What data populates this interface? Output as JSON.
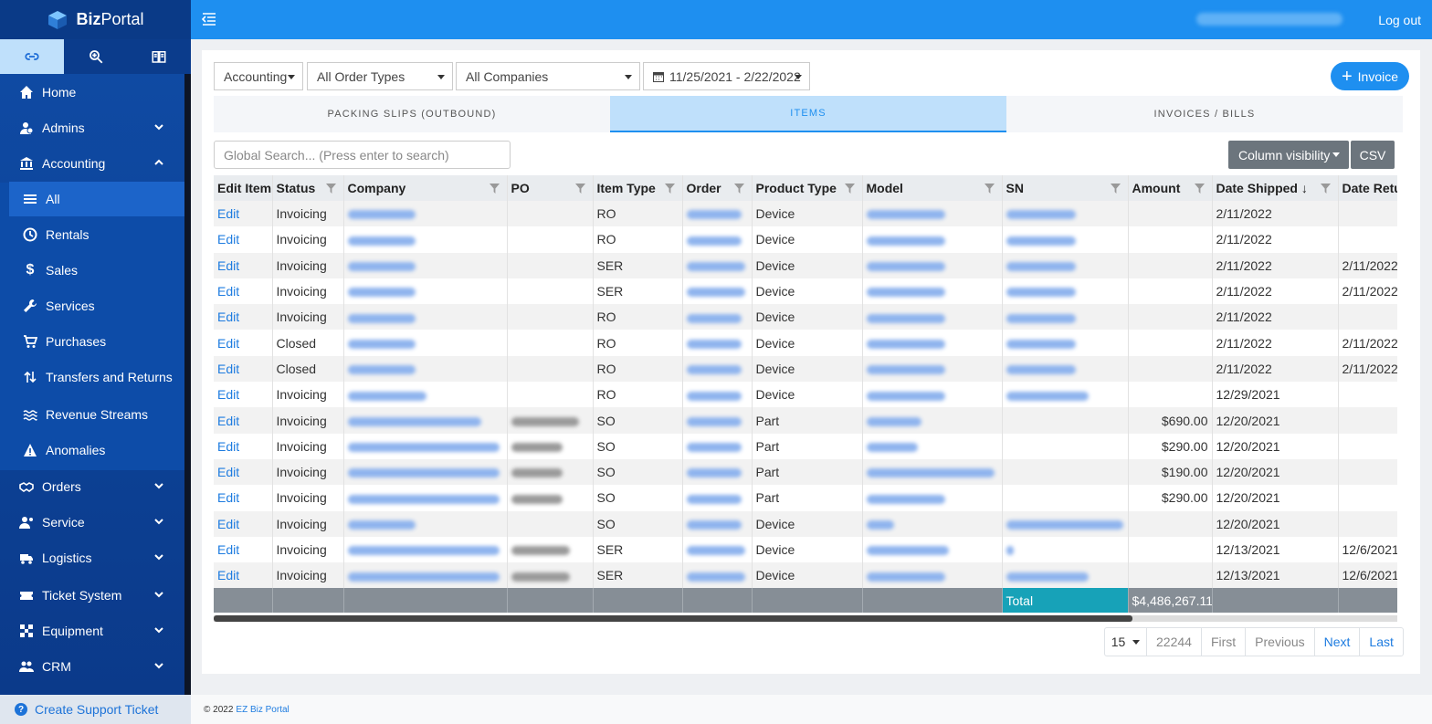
{
  "brand": {
    "name_bold": "Biz",
    "name_rest": "Portal"
  },
  "topbar": {
    "logout": "Log out"
  },
  "nav": {
    "items": [
      {
        "label": "Home",
        "icon": "home-icon"
      },
      {
        "label": "Admins",
        "icon": "admins-icon"
      },
      {
        "label": "Accounting",
        "icon": "bank-icon"
      },
      {
        "label": "All",
        "icon": "list-icon"
      },
      {
        "label": "Rentals",
        "icon": "clock-icon"
      },
      {
        "label": "Sales",
        "icon": "dollar-icon"
      },
      {
        "label": "Services",
        "icon": "wrench-icon"
      },
      {
        "label": "Purchases",
        "icon": "cart-icon"
      },
      {
        "label": "Transfers and Returns",
        "icon": "transfer-icon"
      },
      {
        "label": "Revenue Streams",
        "icon": "stream-icon"
      },
      {
        "label": "Anomalies",
        "icon": "warning-icon"
      },
      {
        "label": "Orders",
        "icon": "handshake-icon"
      },
      {
        "label": "Service",
        "icon": "service-icon"
      },
      {
        "label": "Logistics",
        "icon": "truck-icon"
      },
      {
        "label": "Ticket System",
        "icon": "ticket-icon"
      },
      {
        "label": "Equipment",
        "icon": "equipment-icon"
      },
      {
        "label": "CRM",
        "icon": "crm-icon"
      }
    ],
    "support": "Create Support Ticket"
  },
  "filters": {
    "category": "Accounting",
    "order_types": "All Order Types",
    "companies": "All Companies",
    "date_range": "11/25/2021 - 2/22/2022"
  },
  "invoice_button": "Invoice",
  "tabs": [
    "PACKING SLIPS (OUTBOUND)",
    "ITEMS",
    "INVOICES / BILLS"
  ],
  "search": {
    "placeholder": "Global Search... (Press enter to search)"
  },
  "column_visibility": "Column visibility",
  "csv": "CSV",
  "table": {
    "headers": [
      "Edit Item",
      "Status",
      "Company",
      "PO",
      "Item Type",
      "Order",
      "Product Type",
      "Model",
      "SN",
      "Amount",
      "Date Shipped",
      "Date Retu"
    ],
    "rows": [
      {
        "edit": "Edit",
        "status": "Invoicing",
        "item_type": "RO",
        "product_type": "Device",
        "amount": "",
        "date_shipped": "2/11/2022",
        "date_returned": ""
      },
      {
        "edit": "Edit",
        "status": "Invoicing",
        "item_type": "RO",
        "product_type": "Device",
        "amount": "",
        "date_shipped": "2/11/2022",
        "date_returned": ""
      },
      {
        "edit": "Edit",
        "status": "Invoicing",
        "item_type": "SER",
        "product_type": "Device",
        "amount": "",
        "date_shipped": "2/11/2022",
        "date_returned": "2/11/2022"
      },
      {
        "edit": "Edit",
        "status": "Invoicing",
        "item_type": "SER",
        "product_type": "Device",
        "amount": "",
        "date_shipped": "2/11/2022",
        "date_returned": "2/11/2022"
      },
      {
        "edit": "Edit",
        "status": "Invoicing",
        "item_type": "RO",
        "product_type": "Device",
        "amount": "",
        "date_shipped": "2/11/2022",
        "date_returned": ""
      },
      {
        "edit": "Edit",
        "status": "Closed",
        "item_type": "RO",
        "product_type": "Device",
        "amount": "",
        "date_shipped": "2/11/2022",
        "date_returned": "2/11/2022"
      },
      {
        "edit": "Edit",
        "status": "Closed",
        "item_type": "RO",
        "product_type": "Device",
        "amount": "",
        "date_shipped": "2/11/2022",
        "date_returned": "2/11/2022"
      },
      {
        "edit": "Edit",
        "status": "Invoicing",
        "item_type": "RO",
        "product_type": "Device",
        "amount": "",
        "date_shipped": "12/29/2021",
        "date_returned": ""
      },
      {
        "edit": "Edit",
        "status": "Invoicing",
        "item_type": "SO",
        "product_type": "Part",
        "amount": "$690.00",
        "date_shipped": "12/20/2021",
        "date_returned": ""
      },
      {
        "edit": "Edit",
        "status": "Invoicing",
        "item_type": "SO",
        "product_type": "Part",
        "amount": "$290.00",
        "date_shipped": "12/20/2021",
        "date_returned": ""
      },
      {
        "edit": "Edit",
        "status": "Invoicing",
        "item_type": "SO",
        "product_type": "Part",
        "amount": "$190.00",
        "date_shipped": "12/20/2021",
        "date_returned": ""
      },
      {
        "edit": "Edit",
        "status": "Invoicing",
        "item_type": "SO",
        "product_type": "Part",
        "amount": "$290.00",
        "date_shipped": "12/20/2021",
        "date_returned": ""
      },
      {
        "edit": "Edit",
        "status": "Invoicing",
        "item_type": "SO",
        "product_type": "Device",
        "amount": "",
        "date_shipped": "12/20/2021",
        "date_returned": ""
      },
      {
        "edit": "Edit",
        "status": "Invoicing",
        "item_type": "SER",
        "product_type": "Device",
        "amount": "",
        "date_shipped": "12/13/2021",
        "date_returned": "12/6/2021"
      },
      {
        "edit": "Edit",
        "status": "Invoicing",
        "item_type": "SER",
        "product_type": "Device",
        "amount": "",
        "date_shipped": "12/13/2021",
        "date_returned": "12/6/2021"
      }
    ],
    "total_label": "Total",
    "total_amount": "$4,486,267.11"
  },
  "pager": {
    "page_size": "15",
    "total": "22244",
    "first": "First",
    "previous": "Previous",
    "next": "Next",
    "last": "Last"
  },
  "footer": {
    "copyright": "© 2022",
    "brand_link": "EZ Biz Portal"
  }
}
